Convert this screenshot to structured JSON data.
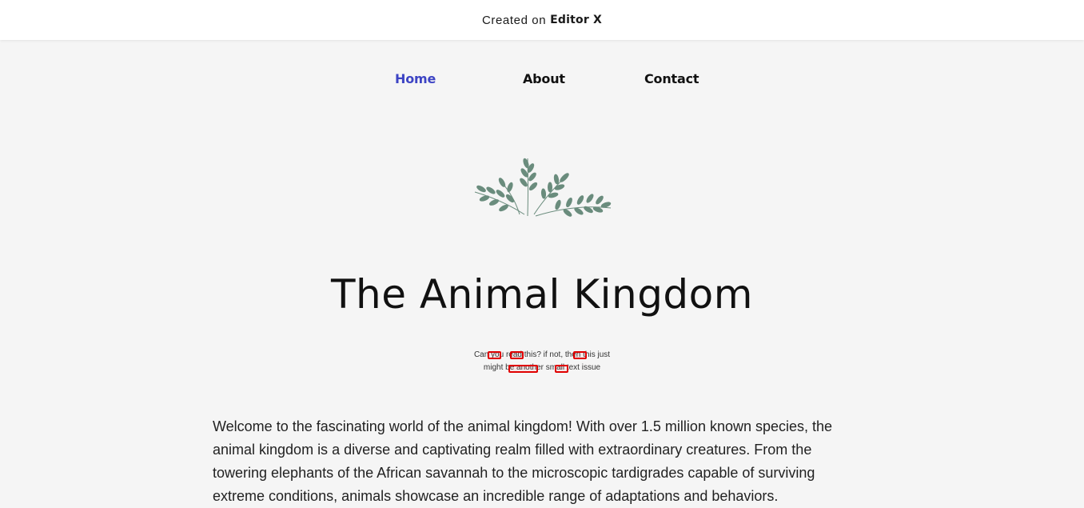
{
  "topbar": {
    "created_label": "Created on",
    "brand_label": "Editor X"
  },
  "nav": {
    "items": [
      {
        "label": "Home",
        "active": true
      },
      {
        "label": "About",
        "active": false
      },
      {
        "label": "Contact",
        "active": false
      }
    ]
  },
  "hero": {
    "illustration": "fern-leaves-icon",
    "title": "The Animal Kingdom",
    "small_text_line1": "Can you read this? if not, then this just",
    "small_text_line2": "might be another small text issue"
  },
  "body": {
    "intro": "Welcome to the fascinating world of the animal kingdom! With over 1.5 million known species, the animal kingdom is a diverse and captivating realm filled with extraordinary creatures. From the towering elephants of the African savannah to the microscopic tardigrades capable of surviving extreme conditions, animals showcase an incredible range of adaptations and behaviors."
  },
  "colors": {
    "background": "#f5f5f5",
    "nav_active": "#3d44c4",
    "plant": "#6a8c7d",
    "highlight_marker": "#e00000"
  }
}
